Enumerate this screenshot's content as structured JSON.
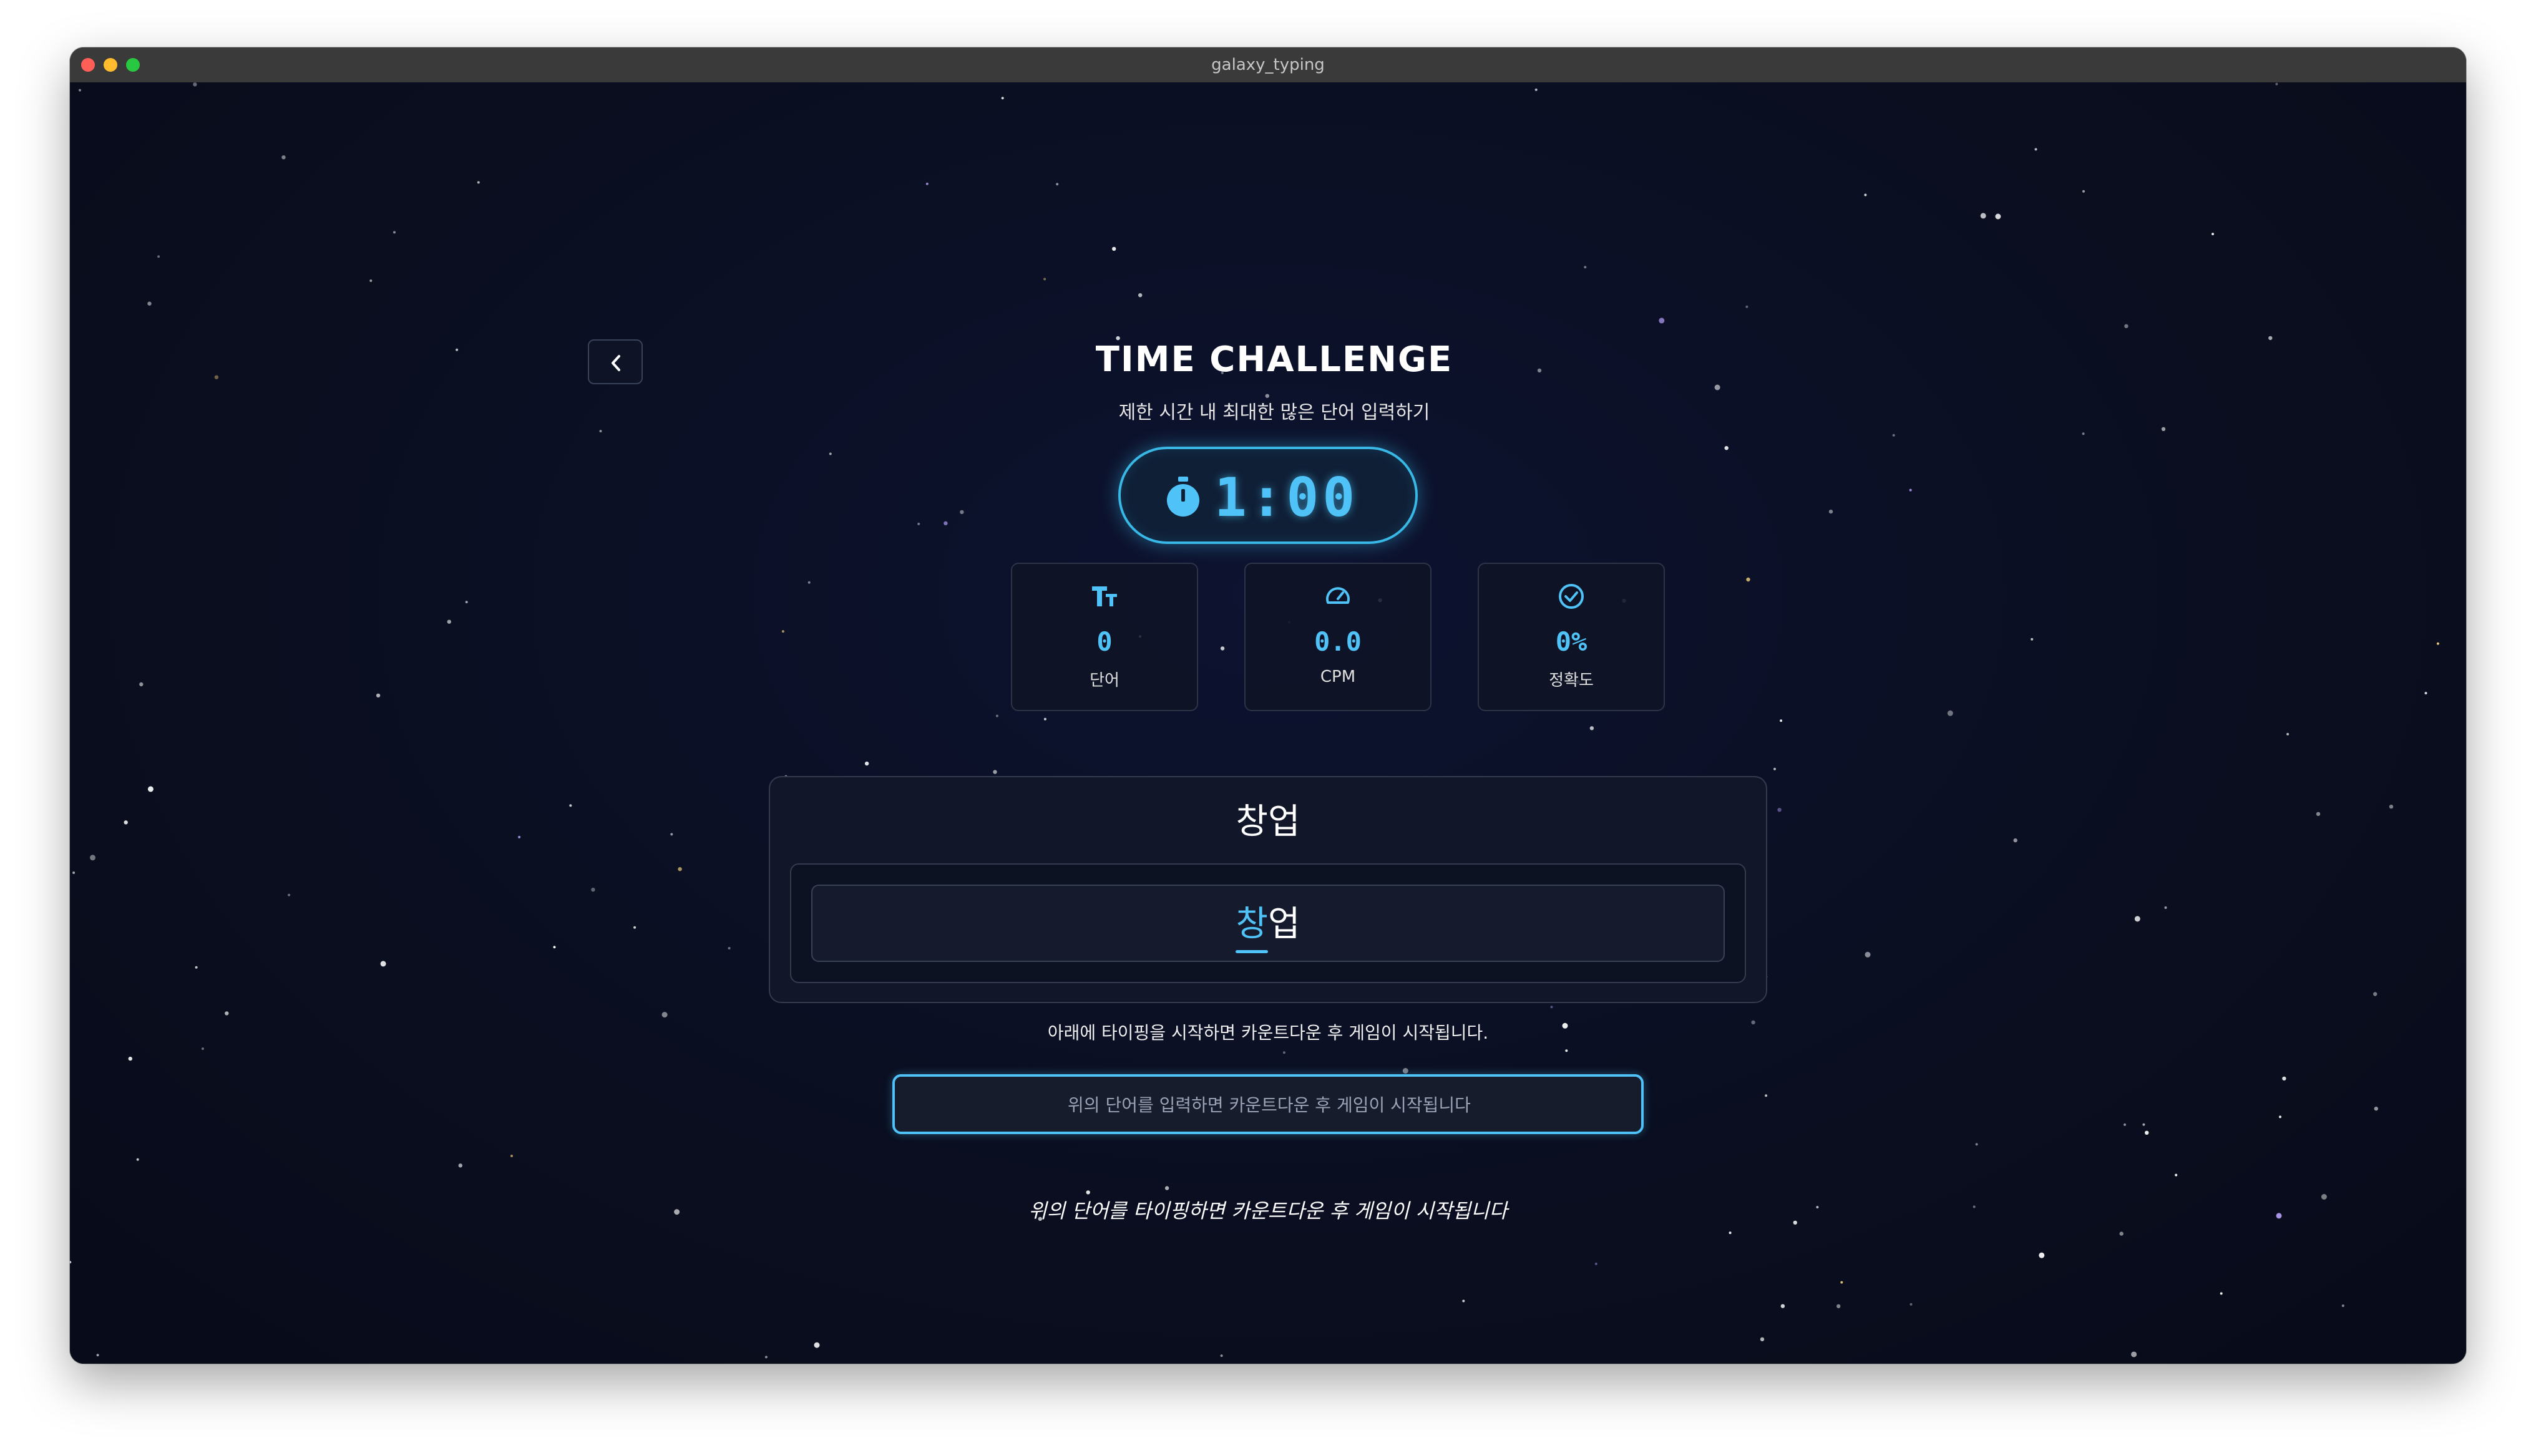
{
  "window": {
    "title": "galaxy_typing"
  },
  "header": {
    "title": "TIME CHALLENGE",
    "subtitle": "제한 시간 내 최대한 많은 단어 입력하기"
  },
  "timer": {
    "time": "1:00"
  },
  "stats": [
    {
      "icon": "text-size-icon",
      "value": "0",
      "label": "단어"
    },
    {
      "icon": "speedometer-icon",
      "value": "0.0",
      "label": "CPM"
    },
    {
      "icon": "check-circle-icon",
      "value": "0%",
      "label": "정확도"
    }
  ],
  "word": {
    "target": "창업",
    "typed_done": "창",
    "typed_rest": "업"
  },
  "hint": "아래에 타이핑을 시작하면 카운트다운 후 게임이 시작됩니다.",
  "input": {
    "placeholder": "위의 단어를 입력하면 카운트다운 후 게임이 시작됩니다",
    "value": ""
  },
  "footer_hint": "위의 단어를 타이핑하면 카운트다운 후 게임이 시작됩니다",
  "colors": {
    "accent": "#4fc3f7",
    "background": "#0a0e1f"
  }
}
